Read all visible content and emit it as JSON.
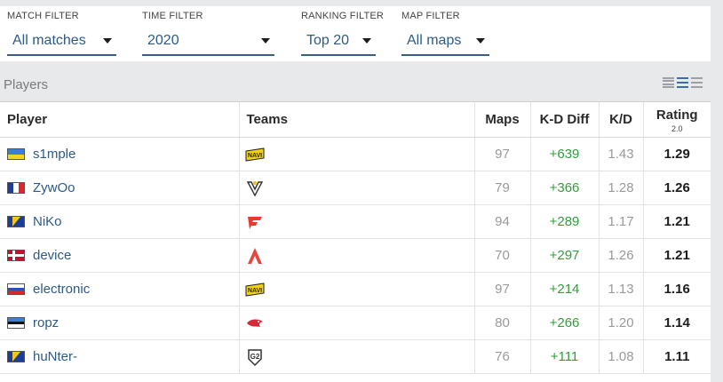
{
  "filters": [
    {
      "label": "MATCH FILTER",
      "value": "All matches"
    },
    {
      "label": "TIME FILTER",
      "value": "2020"
    },
    {
      "label": "RANKING FILTER",
      "value": "Top 20"
    },
    {
      "label": "MAP FILTER",
      "value": "All maps"
    }
  ],
  "section_title": "Players",
  "table": {
    "headers": {
      "player": "Player",
      "teams": "Teams",
      "maps": "Maps",
      "kd_diff": "K-D Diff",
      "kd": "K/D",
      "rating": "Rating",
      "rating_version": "2.0"
    },
    "rows": [
      {
        "player": "s1mple",
        "flag": "ukraine-flag",
        "team": "natus-vincere-logo",
        "maps": "97",
        "kd_diff": "+639",
        "kd": "1.43",
        "rating": "1.29"
      },
      {
        "player": "ZywOo",
        "flag": "france-flag",
        "team": "vitality-logo",
        "maps": "79",
        "kd_diff": "+366",
        "kd": "1.28",
        "rating": "1.26"
      },
      {
        "player": "NiKo",
        "flag": "bosnia-flag",
        "team": "faze-logo",
        "maps": "94",
        "kd_diff": "+289",
        "kd": "1.17",
        "rating": "1.21"
      },
      {
        "player": "device",
        "flag": "denmark-flag",
        "team": "astralis-logo",
        "maps": "70",
        "kd_diff": "+297",
        "kd": "1.26",
        "rating": "1.21"
      },
      {
        "player": "electronic",
        "flag": "russia-flag",
        "team": "natus-vincere-logo",
        "maps": "97",
        "kd_diff": "+214",
        "kd": "1.13",
        "rating": "1.16"
      },
      {
        "player": "ropz",
        "flag": "estonia-flag",
        "team": "mousesports-logo",
        "maps": "80",
        "kd_diff": "+266",
        "kd": "1.20",
        "rating": "1.14"
      },
      {
        "player": "huNter-",
        "flag": "bosnia-flag",
        "team": "g2-logo",
        "maps": "76",
        "kd_diff": "+111",
        "kd": "1.08",
        "rating": "1.11"
      }
    ]
  },
  "colors": {
    "link": "#2e5a86",
    "positive": "#2e9e3a",
    "muted": "#9a9a9a",
    "underline": "#3a5f85",
    "page_bg": "#e8e9eb"
  }
}
